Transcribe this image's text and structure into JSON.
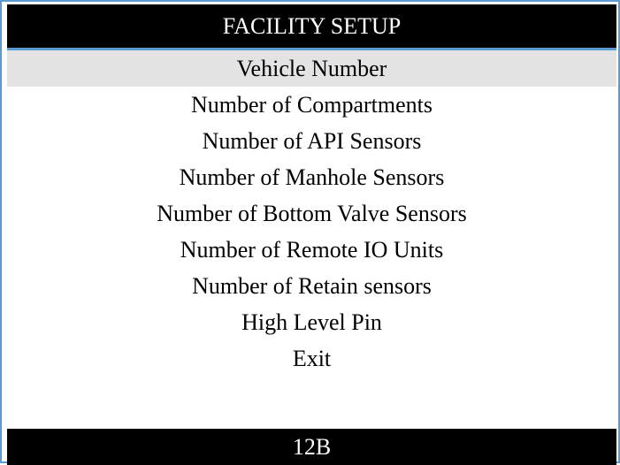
{
  "header": {
    "title": "FACILITY SETUP"
  },
  "menu": {
    "selected_index": 0,
    "items": [
      {
        "label": "Vehicle Number"
      },
      {
        "label": "Number of Compartments"
      },
      {
        "label": "Number of API Sensors"
      },
      {
        "label": "Number of Manhole Sensors"
      },
      {
        "label": "Number of Bottom Valve Sensors"
      },
      {
        "label": "Number of Remote IO Units"
      },
      {
        "label": "Number of Retain sensors"
      },
      {
        "label": "High Level Pin"
      },
      {
        "label": "Exit"
      }
    ]
  },
  "footer": {
    "status_text": "12B"
  },
  "colors": {
    "frame_border": "#5b9bd5",
    "title_background": "#000000",
    "title_text": "#ffffff",
    "selected_background": "#e3e3e3"
  }
}
